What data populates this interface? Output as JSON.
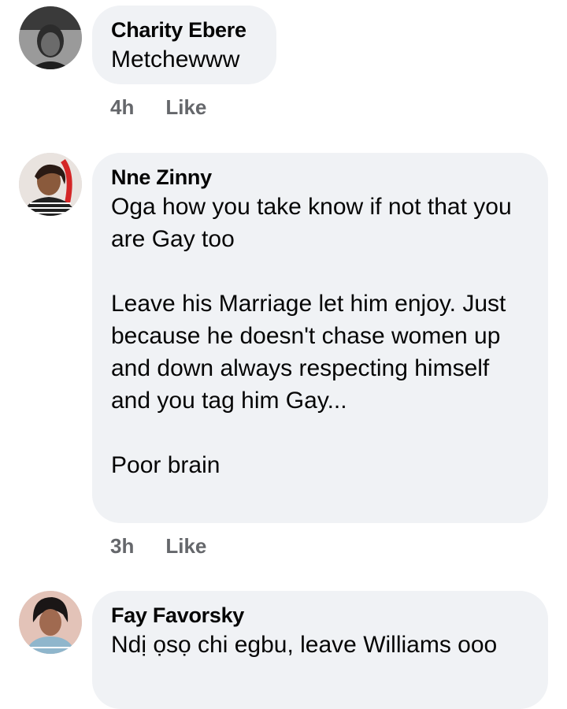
{
  "comments": [
    {
      "author": "Charity Ebere",
      "text": "Metchewww",
      "time": "4h",
      "like_label": "Like"
    },
    {
      "author": "Nne Zinny",
      "text": "Oga how you take know if not that you are Gay too\n\nLeave his Marriage let him enjoy. Just because he doesn't chase women up and down always respecting himself and you tag him Gay...\n\nPoor brain",
      "time": "3h",
      "like_label": "Like"
    },
    {
      "author": "Fay Favorsky",
      "text": "Ndị ọsọ chi egbu, leave Williams ooo"
    }
  ],
  "colors": {
    "bubble_background": "#f0f2f5",
    "meta_text": "#65676b",
    "body_text": "#050505"
  }
}
